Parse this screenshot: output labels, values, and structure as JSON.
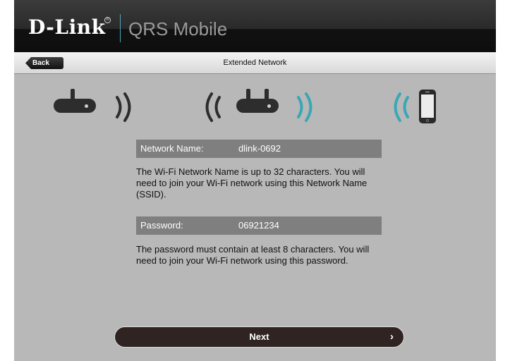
{
  "header": {
    "brand": "D-Link",
    "brand_mark": "R",
    "app_title": "QRS Mobile"
  },
  "navbar": {
    "back_label": "Back",
    "title": "Extended Network"
  },
  "illustration": {
    "icons": [
      "router-icon",
      "wifi-waves-icon",
      "router-icon",
      "wifi-waves-icon",
      "wifi-waves-icon",
      "smartphone-icon"
    ],
    "dark_color": "#2d2d2d",
    "accent_color": "#3aa7b5"
  },
  "network": {
    "name_label": "Network Name:",
    "name_value": "dlink-0692",
    "name_description": "The Wi-Fi Network Name is up to 32 characters. You will need to join your Wi-Fi network using this Network Name (SSID).",
    "password_label": "Password:",
    "password_value": "06921234",
    "password_description": "The password must contain at least 8 characters. You will need to join your Wi-Fi network using this password."
  },
  "footer": {
    "next_label": "Next",
    "next_chevron": "›"
  }
}
